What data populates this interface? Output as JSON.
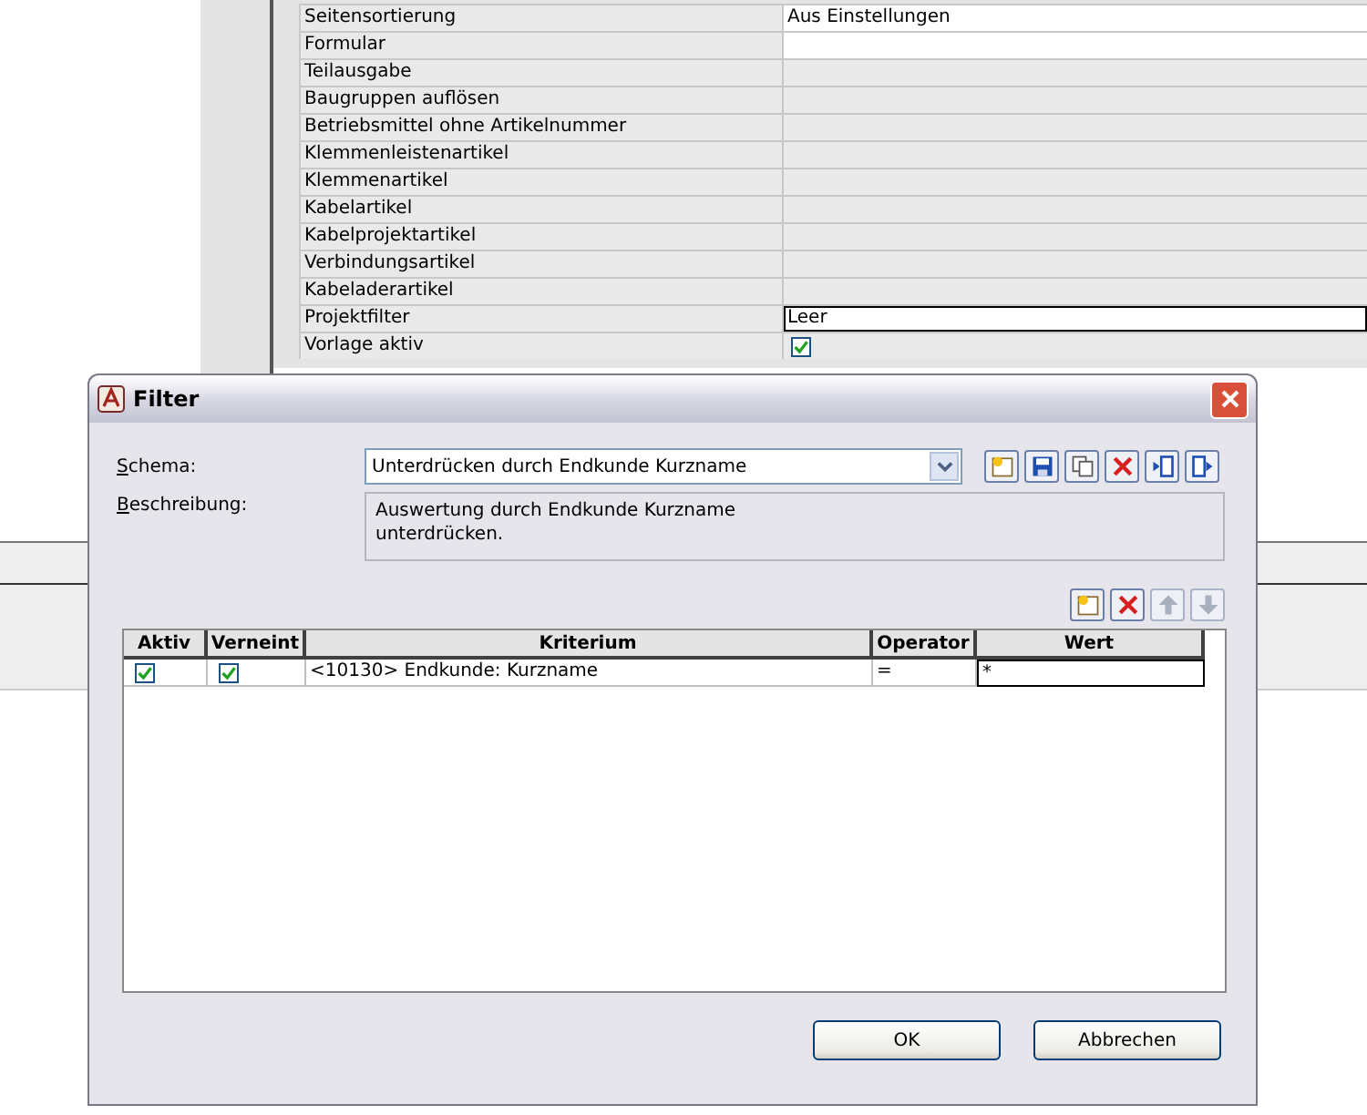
{
  "properties": [
    {
      "name": "Seitensortierung",
      "value": "Aus Einstellungen",
      "kind": "text"
    },
    {
      "name": "Formular",
      "kind": "text"
    },
    {
      "name": "Teilausgabe",
      "kind": "readonly"
    },
    {
      "name": "Baugruppen auflösen",
      "kind": "readonly"
    },
    {
      "name": "Betriebsmittel ohne Artikelnummer",
      "kind": "readonly"
    },
    {
      "name": "Klemmenleistenartikel",
      "kind": "readonly"
    },
    {
      "name": "Klemmenartikel",
      "kind": "readonly"
    },
    {
      "name": "Kabelartikel",
      "kind": "readonly"
    },
    {
      "name": "Kabelprojektartikel",
      "kind": "readonly"
    },
    {
      "name": "Verbindungsartikel",
      "kind": "readonly"
    },
    {
      "name": "Kabeladerartikel",
      "kind": "readonly"
    },
    {
      "name": "Projektfilter",
      "value": "Leer",
      "kind": "field"
    },
    {
      "name": "Vorlage aktiv",
      "kind": "checkbox",
      "checked": true
    }
  ],
  "dialog": {
    "title": "Filter",
    "schema_label": "Schema:",
    "schema_value": "Unterdrücken durch Endkunde Kurzname",
    "description_label": "Beschreibung:",
    "description": "Auswertung durch Endkunde Kurzname\nunterdrücken.",
    "schema_tools": [
      {
        "kind": "new"
      },
      {
        "kind": "save"
      },
      {
        "kind": "copy"
      },
      {
        "kind": "delete"
      },
      {
        "kind": "import"
      },
      {
        "kind": "export"
      }
    ],
    "row_tools": [
      {
        "kind": "new",
        "disabled": false
      },
      {
        "kind": "delete",
        "disabled": false
      },
      {
        "kind": "up",
        "disabled": true
      },
      {
        "kind": "down",
        "disabled": true
      }
    ],
    "columns": [
      "Aktiv",
      "Verneint",
      "Kriterium",
      "Operator",
      "Wert"
    ],
    "rows": [
      {
        "aktiv": true,
        "verneint": true,
        "kriterium": "<10130> Endkunde: Kurzname",
        "operator": "=",
        "wert": "*"
      }
    ],
    "buttons": [
      "OK",
      "Abbrechen"
    ]
  }
}
